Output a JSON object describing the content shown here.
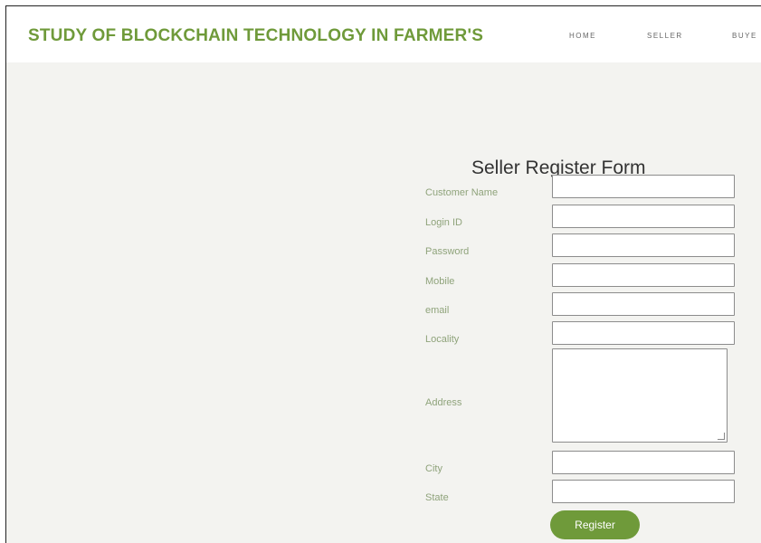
{
  "header": {
    "brand": "STUDY OF BLOCKCHAIN TECHNOLOGY IN FARMER'S",
    "nav": [
      "HOME",
      "SELLER",
      "BUYE"
    ]
  },
  "form": {
    "title": "Seller Register Form",
    "labels": {
      "customer_name": "Customer Name",
      "login_id": "Login ID",
      "password": "Password",
      "mobile": "Mobile",
      "email": "email",
      "locality": "Locality",
      "address": "Address",
      "city": "City",
      "state": "State"
    },
    "register_label": "Register"
  },
  "colors": {
    "brand_green": "#6f9a3a",
    "label_green": "#8fa37b",
    "background": "#f3f3f0"
  }
}
